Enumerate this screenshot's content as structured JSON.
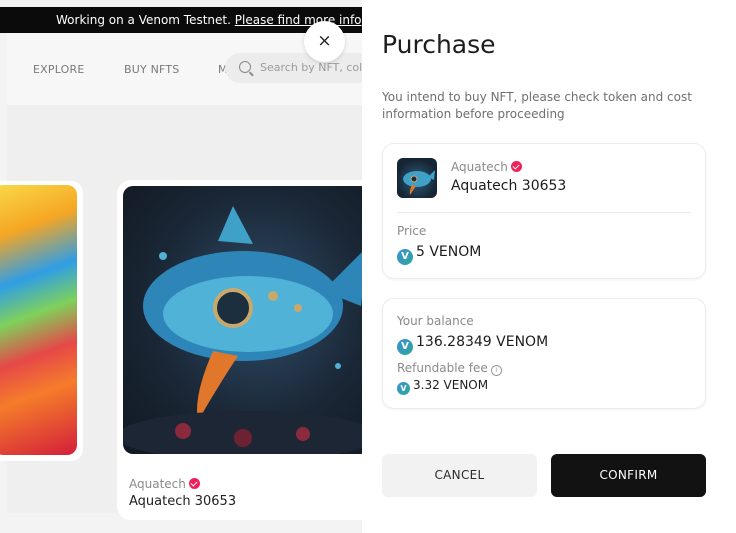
{
  "banner": {
    "text": "Working on a Venom Testnet. ",
    "link": "Please find more info"
  },
  "nav": {
    "explore": "EXPLORE",
    "buy_nfts": "BUY NFTS",
    "more": "M",
    "search_placeholder": "Search by NFT, collection"
  },
  "background_card": {
    "collection": "Aquatech",
    "name": "Aquatech 30653"
  },
  "close_label": "×",
  "modal": {
    "title": "Purchase",
    "intro": "You intend to buy NFT, please check token and cost information before proceeding",
    "nft": {
      "collection": "Aquatech",
      "name": "Aquatech 30653"
    },
    "price_label": "Price",
    "price_value": "5 VENOM",
    "balance_label": "Your balance",
    "balance_value": "136.28349 VENOM",
    "fee_label": "Refundable fee",
    "fee_value": "3.32 VENOM",
    "token_icon": "venom-token-icon",
    "cancel_label": "CANCEL",
    "confirm_label": "CONFIRM"
  },
  "colors": {
    "verified_badge": "#ee2059",
    "confirm_bg": "#121212",
    "cancel_bg": "#f2f2f2"
  }
}
